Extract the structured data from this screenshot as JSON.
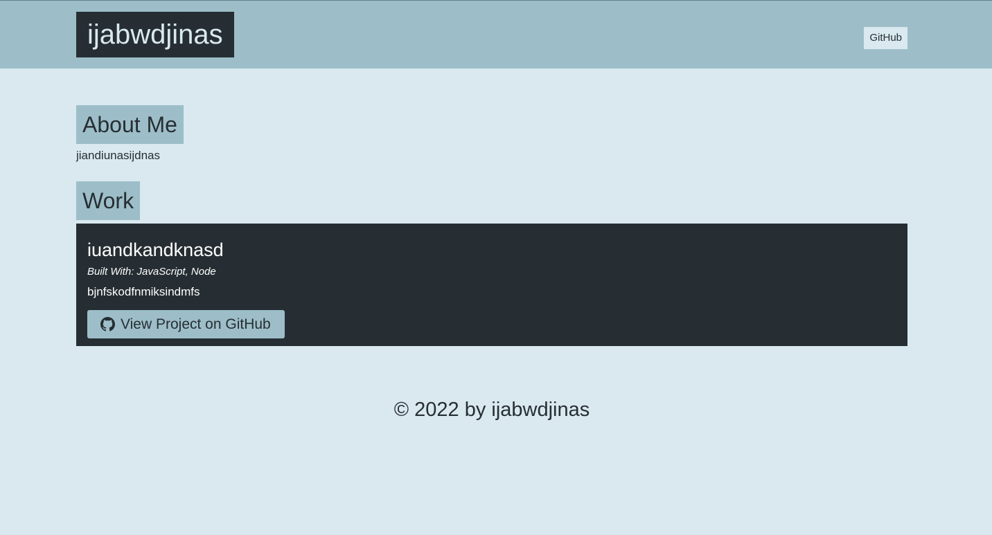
{
  "header": {
    "brand": "ijabwdjinas",
    "nav_github": "GitHub"
  },
  "about": {
    "title": "About Me",
    "text": "jiandiunasijdnas"
  },
  "work": {
    "title": "Work",
    "projects": [
      {
        "title": "iuandkandknasd",
        "tech": "Built With: JavaScript, Node",
        "description": "bjnfskodfnmiksindmfs",
        "button_label": "View Project on GitHub",
        "button_icon": "github-icon"
      }
    ]
  },
  "footer": {
    "text": "© 2022 by ijabwdjinas"
  },
  "colors": {
    "background": "#d9e9ef",
    "header": "#9dbec8",
    "dark": "#262e33",
    "accent": "#9dbec8"
  }
}
